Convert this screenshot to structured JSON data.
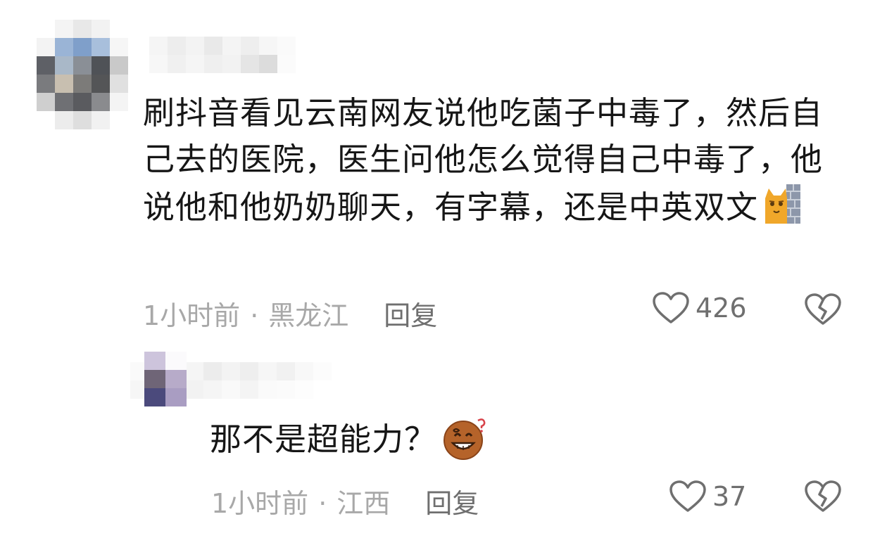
{
  "comments": [
    {
      "text": "刷抖音看见云南网友说他吃菌子中毒了，然后自己去的医院，医生问他怎么觉得自己中毒了，他说他和他奶奶聊天，有字幕，还是中英双文",
      "emoji": "cat-behind-wall-emoji",
      "time": "1小时前",
      "separator": "·",
      "location": "黑龙江",
      "reply_label": "回复",
      "likes": "426"
    }
  ],
  "replies": [
    {
      "text": "那不是超能力？",
      "emoji": "dizzy-grin-emoji",
      "time": "1小时前",
      "separator": "·",
      "location": "江西",
      "reply_label": "回复",
      "likes": "37"
    }
  ],
  "colors": {
    "text": "#161616",
    "meta": "#a8a8a8",
    "action": "#6f6f6f",
    "cat": "#f0a72a",
    "wall": "#8d97aa",
    "face": "#b5632a"
  }
}
